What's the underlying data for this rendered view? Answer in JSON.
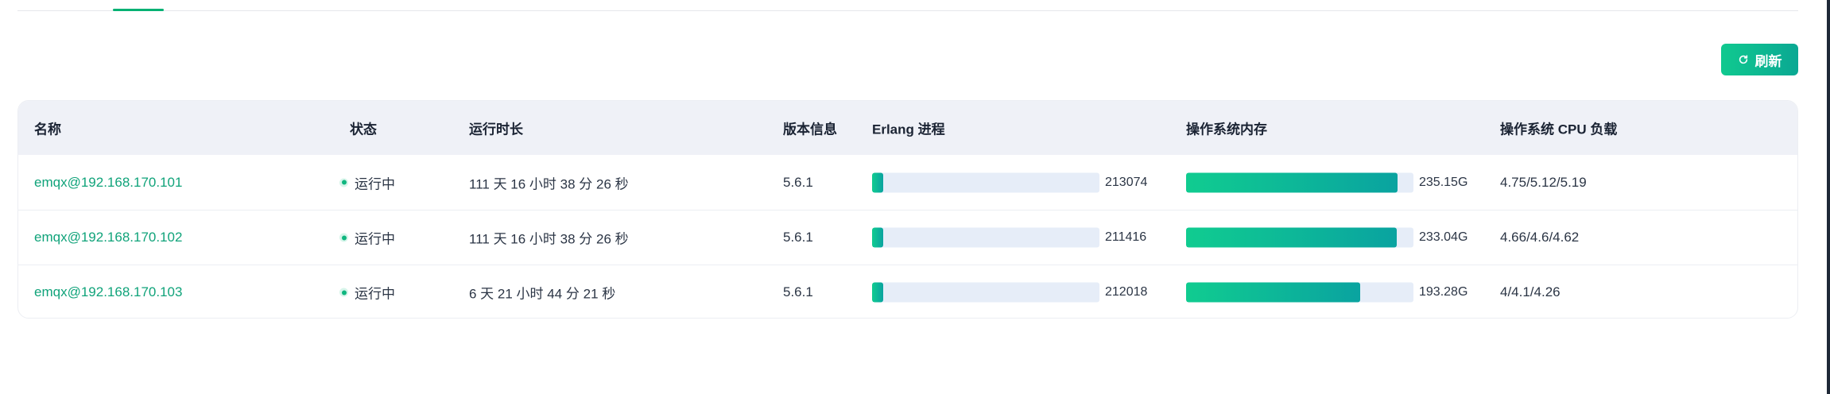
{
  "toolbar": {
    "refresh_label": "刷新"
  },
  "table": {
    "headers": {
      "name": "名称",
      "status": "状态",
      "uptime": "运行时长",
      "version": "版本信息",
      "erlang": "Erlang 进程",
      "memory": "操作系统内存",
      "cpu": "操作系统 CPU 负载"
    },
    "rows": [
      {
        "name": "emqx@192.168.170.101",
        "status": "运行中",
        "uptime": "111 天 16 小时 38 分 26 秒",
        "version": "5.6.1",
        "erlang_value": "213074",
        "erlang_fraction": 0.05,
        "memory_value": "235.15G",
        "memory_fraction": 0.93,
        "cpu": "4.75/5.12/5.19"
      },
      {
        "name": "emqx@192.168.170.102",
        "status": "运行中",
        "uptime": "111 天 16 小时 38 分 26 秒",
        "version": "5.6.1",
        "erlang_value": "211416",
        "erlang_fraction": 0.05,
        "memory_value": "233.04G",
        "memory_fraction": 0.925,
        "cpu": "4.66/4.6/4.62"
      },
      {
        "name": "emqx@192.168.170.103",
        "status": "运行中",
        "uptime": "6 天 21 小时 44 分 21 秒",
        "version": "5.6.1",
        "erlang_value": "212018",
        "erlang_fraction": 0.05,
        "memory_value": "193.28G",
        "memory_fraction": 0.765,
        "cpu": "4/4.1/4.26"
      }
    ]
  },
  "colors": {
    "accent": "#10a37a",
    "bar_track": "#e6edf8",
    "header_bg": "#eff1f7"
  }
}
